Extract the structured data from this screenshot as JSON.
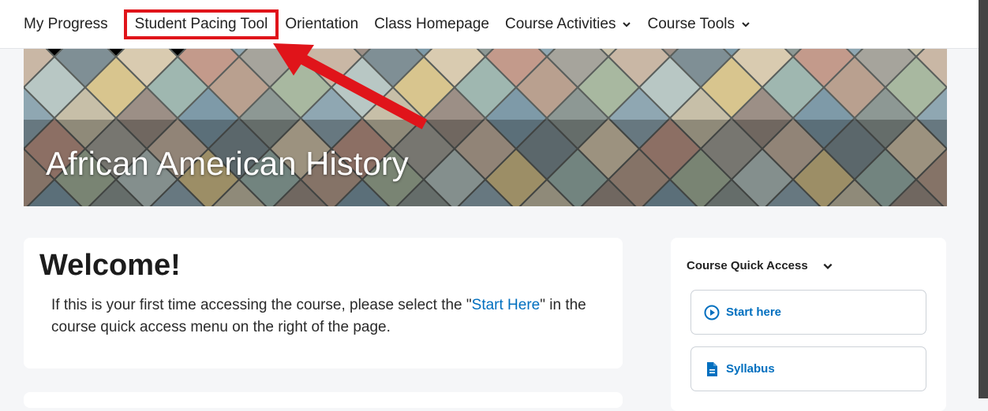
{
  "nav": {
    "items": [
      {
        "label": "My Progress"
      },
      {
        "label": "Student Pacing Tool"
      },
      {
        "label": "Orientation"
      },
      {
        "label": "Class Homepage"
      },
      {
        "label": "Course Activities"
      },
      {
        "label": "Course Tools"
      }
    ]
  },
  "hero": {
    "title": "African American History"
  },
  "welcome": {
    "title": "Welcome!",
    "text_before": "If this is your first time accessing the course, please select the \"",
    "link": "Start Here",
    "text_after": "\" in the course quick access menu on the right of the page."
  },
  "quick_access": {
    "title": "Course Quick Access",
    "items": [
      {
        "label": "Start here",
        "icon": "play-circle-icon"
      },
      {
        "label": "Syllabus",
        "icon": "document-icon"
      }
    ]
  },
  "colors": {
    "highlight": "#e0141a",
    "link": "#006fbf"
  }
}
